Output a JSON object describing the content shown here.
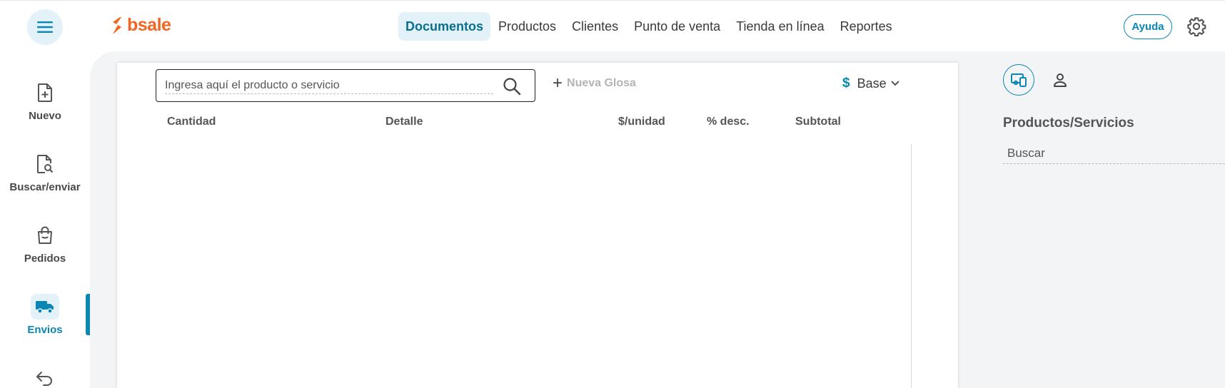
{
  "header": {
    "logo_text": "bsale",
    "nav": [
      "Documentos",
      "Productos",
      "Clientes",
      "Punto de venta",
      "Tienda en línea",
      "Reportes"
    ],
    "active_nav": "Documentos",
    "help_label": "Ayuda"
  },
  "sidebar": {
    "items": [
      {
        "label": "Nuevo",
        "icon": "file-plus-icon"
      },
      {
        "label": "Buscar/enviar",
        "icon": "file-search-icon"
      },
      {
        "label": "Pedidos",
        "icon": "shopping-bag-icon"
      },
      {
        "label": "Envios",
        "icon": "truck-icon",
        "active": true
      },
      {
        "label": "",
        "icon": "return-arrow-icon"
      }
    ]
  },
  "document": {
    "search_placeholder": "Ingresa aquí el producto o servicio",
    "new_glosa_label": "Nueva Glosa",
    "price_list_symbol": "$",
    "price_list_label": "Base",
    "columns": [
      "Cantidad",
      "Detalle",
      "$/unidad",
      "% desc.",
      "Subtotal"
    ]
  },
  "right_panel": {
    "title": "Productos/Servicios",
    "search_placeholder": "Buscar"
  },
  "colors": {
    "brand_orange": "#f26522",
    "accent_blue": "#0a86b3",
    "active_bg": "#e3f2f9"
  }
}
